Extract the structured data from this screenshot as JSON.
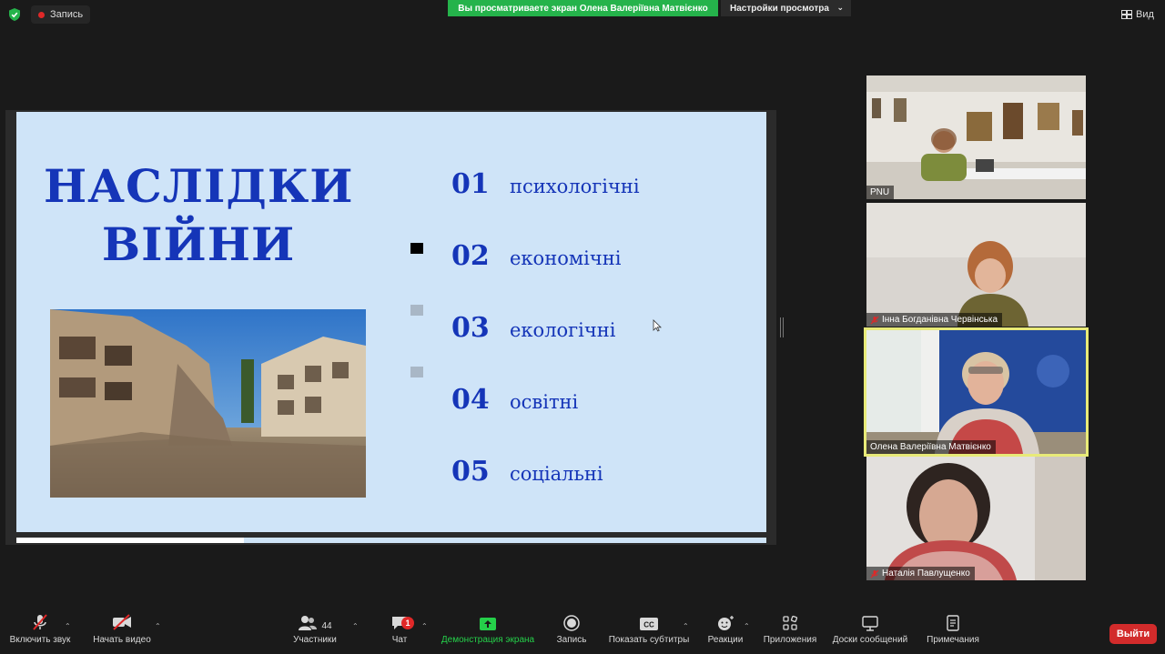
{
  "topbar": {
    "recording_label": "Запись",
    "share_banner": "Вы просматриваете экран Олена Валеріївна Матвієнко",
    "view_settings_label": "Настройки просмотра",
    "view_label": "Вид"
  },
  "slide": {
    "title_line1": "НАСЛІДКИ",
    "title_line2": "ВІЙНИ",
    "items": [
      {
        "num": "01",
        "label": "психологічні"
      },
      {
        "num": "02",
        "label": "економічні"
      },
      {
        "num": "03",
        "label": "екологічні"
      },
      {
        "num": "04",
        "label": "освітні"
      },
      {
        "num": "05",
        "label": "соціальні"
      }
    ]
  },
  "participants": [
    {
      "name": "PNU",
      "muted": false
    },
    {
      "name": "Інна Богданівна Червінська",
      "muted": true
    },
    {
      "name": "Олена Валеріївна Матвієнко",
      "muted": false,
      "active": true
    },
    {
      "name": "Наталія Павлущенко",
      "muted": true
    }
  ],
  "toolbar": {
    "mute_label": "Включить звук",
    "video_label": "Начать видео",
    "participants_label": "Участники",
    "participants_count": "44",
    "chat_label": "Чат",
    "chat_badge": "1",
    "share_label": "Демонстрация экрана",
    "record_label": "Запись",
    "captions_label": "Показать субтитры",
    "captions_icon_text": "CC",
    "reactions_label": "Реакции",
    "apps_label": "Приложения",
    "whiteboard_label": "Доски сообщений",
    "notes_label": "Примечания",
    "leave_label": "Выйти"
  },
  "colors": {
    "share_green": "#25b34b",
    "slide_bg": "#cfe4f8",
    "slide_text": "#1535b8",
    "leave_red": "#d22b2b",
    "active_outline": "#e8ea78"
  }
}
